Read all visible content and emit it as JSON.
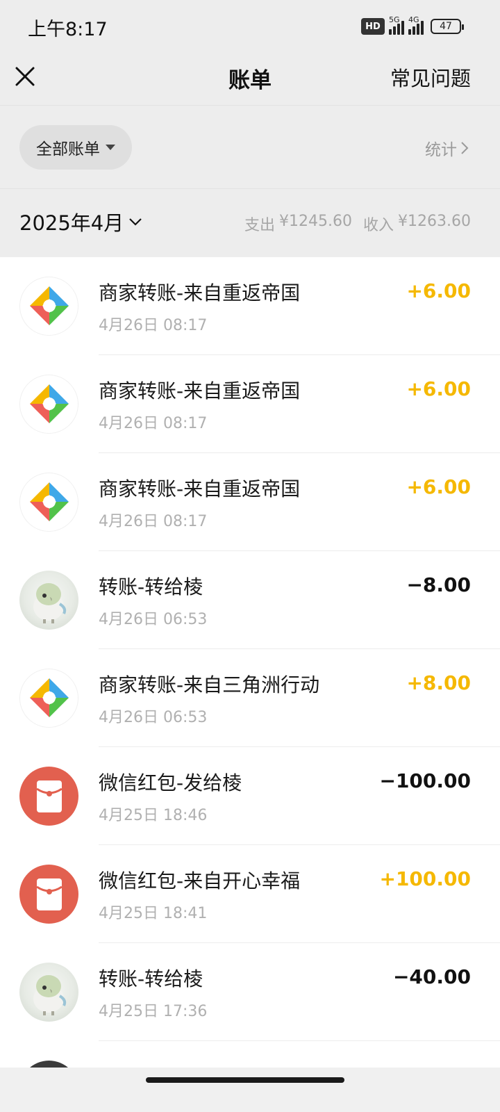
{
  "status_bar": {
    "time": "上午8:17",
    "hd_label": "HD",
    "net1": "5G",
    "net2": "4G",
    "battery": "47"
  },
  "nav": {
    "title": "账单",
    "faq": "常见问题"
  },
  "filter": {
    "label": "全部账单",
    "stats": "统计"
  },
  "month": {
    "label": "2025年4月",
    "expense_label": "支出",
    "expense_value": "¥1245.60",
    "income_label": "收入",
    "income_value": "¥1263.60"
  },
  "colors": {
    "income": "#f5b800",
    "expense": "#111111",
    "red_packet": "#e2604f",
    "background": "#ededed"
  },
  "transactions": [
    {
      "icon": "merchant-transfer-icon",
      "title": "商家转账-来自重返帝国",
      "time": "4月26日 08:17",
      "amount": "+6.00",
      "type": "income"
    },
    {
      "icon": "merchant-transfer-icon",
      "title": "商家转账-来自重返帝国",
      "time": "4月26日 08:17",
      "amount": "+6.00",
      "type": "income"
    },
    {
      "icon": "merchant-transfer-icon",
      "title": "商家转账-来自重返帝国",
      "time": "4月26日 08:17",
      "amount": "+6.00",
      "type": "income"
    },
    {
      "icon": "bird-avatar",
      "title": "转账-转给棱",
      "time": "4月26日 06:53",
      "amount": "−8.00",
      "type": "expense"
    },
    {
      "icon": "merchant-transfer-icon",
      "title": "商家转账-来自三角洲行动",
      "time": "4月26日 06:53",
      "amount": "+8.00",
      "type": "income"
    },
    {
      "icon": "red-packet-icon",
      "title": "微信红包-发给棱",
      "time": "4月25日 18:46",
      "amount": "−100.00",
      "type": "expense"
    },
    {
      "icon": "red-packet-icon",
      "title": "微信红包-来自开心幸福",
      "time": "4月25日 18:41",
      "amount": "+100.00",
      "type": "income"
    },
    {
      "icon": "bird-avatar",
      "title": "转账-转给棱",
      "time": "4月25日 17:36",
      "amount": "−40.00",
      "type": "expense"
    }
  ]
}
